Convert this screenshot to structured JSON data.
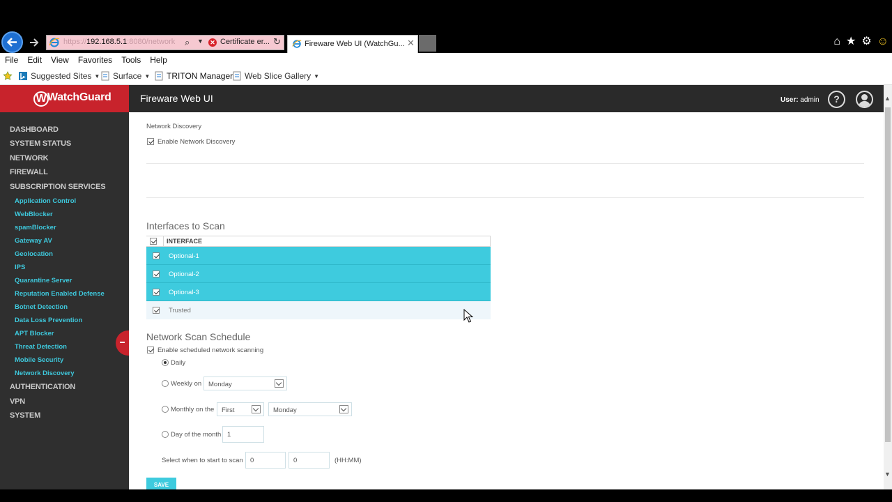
{
  "browser": {
    "address_host": "192.168.5.1",
    "address_rest": ":8080/network",
    "address_blur": "https://",
    "cert_error": "Certificate er...",
    "tab_title": "Fireware Web UI (WatchGu...",
    "menu": [
      "File",
      "Edit",
      "View",
      "Favorites",
      "Tools",
      "Help"
    ],
    "favorites": [
      "Suggested Sites",
      "Surface",
      "TRITON Manager",
      "Web Slice Gallery"
    ]
  },
  "app": {
    "logo": "WatchGuard",
    "title": "Fireware Web UI",
    "user_prefix": "User:",
    "user_name": " admin",
    "help": "?"
  },
  "sidebar": {
    "top_items": [
      "DASHBOARD",
      "SYSTEM STATUS",
      "NETWORK",
      "FIREWALL",
      "SUBSCRIPTION SERVICES"
    ],
    "sub_items": [
      "Application Control",
      "WebBlocker",
      "spamBlocker",
      "Gateway AV",
      "Geolocation",
      "IPS",
      "Quarantine Server",
      "Reputation Enabled Defense",
      "Botnet Detection",
      "Data Loss Prevention",
      "APT Blocker",
      "Threat Detection",
      "Mobile Security",
      "Network Discovery"
    ],
    "bottom_items": [
      "AUTHENTICATION",
      "VPN",
      "SYSTEM"
    ]
  },
  "main": {
    "section_label": "Network Discovery",
    "enable_label": "Enable Network Discovery",
    "enable_checked": true,
    "interfaces_title": "Interfaces to Scan",
    "interfaces_header": "INTERFACE",
    "interfaces": [
      {
        "name": "Optional-1",
        "checked": true,
        "selected": true
      },
      {
        "name": "Optional-2",
        "checked": true,
        "selected": true
      },
      {
        "name": "Optional-3",
        "checked": true,
        "selected": true
      },
      {
        "name": "Trusted",
        "checked": true,
        "selected": false
      }
    ],
    "schedule_title": "Network Scan Schedule",
    "schedule_enable_label": "Enable scheduled network scanning",
    "schedule_enable_checked": true,
    "opt_daily": "Daily",
    "opt_weekly": "Weekly on",
    "weekly_day": "Monday",
    "opt_monthly": "Monthly on the",
    "monthly_ordinal": "First",
    "monthly_day": "Monday",
    "opt_dom": "Day of the month",
    "dom_value": "1",
    "selected_option": "Daily",
    "start_label": "Select when to start to scan",
    "start_hour": "0",
    "start_min": "0",
    "time_format": "(HH:MM)",
    "save_label": "SAVE"
  }
}
